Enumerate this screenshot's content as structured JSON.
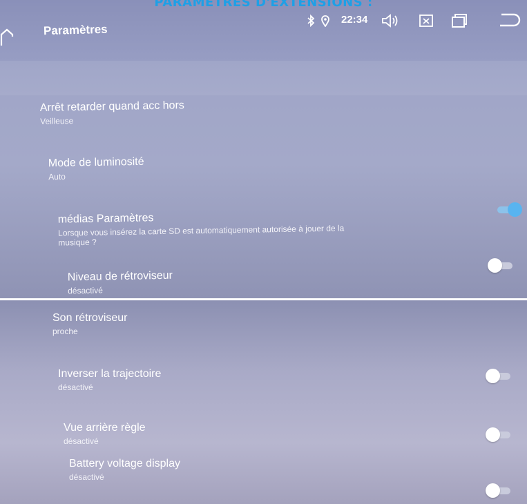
{
  "page_title": "PARAMÈTRES D'EXTENSIONS :",
  "screen": {
    "title": "Paramètres",
    "clock": "22:34",
    "icons": [
      "back-icon",
      "bluetooth-icon",
      "location-icon",
      "volume-icon",
      "close-box-icon",
      "window-icon",
      "return-icon"
    ]
  },
  "settings": [
    {
      "title": "Arrêt retarder quand acc hors",
      "value": "Veilleuse"
    },
    {
      "title": "Mode de luminosité",
      "value": "Auto"
    },
    {
      "title": "médias Paramètres",
      "description_line1": "Lorsque vous insérez la carte SD est automatiquement autorisée à jouer de la",
      "description_line2": "musique ?",
      "toggle": "on"
    },
    {
      "title": "Niveau de rétroviseur",
      "value": "désactivé",
      "toggle": "off"
    },
    {
      "title": "Son rétroviseur",
      "value": "proche"
    },
    {
      "title": "Inverser la trajectoire",
      "value": "désactivé",
      "toggle": "off"
    },
    {
      "title": "Vue arrière règle",
      "value": "désactivé",
      "toggle": "off"
    },
    {
      "title": "Battery voltage display",
      "value": "désactivé",
      "toggle": "off"
    }
  ],
  "colors": {
    "title_accent": "#1ea0e6",
    "toggle_on": "#58b4f0",
    "screen_bg": "#a0a5c7"
  }
}
